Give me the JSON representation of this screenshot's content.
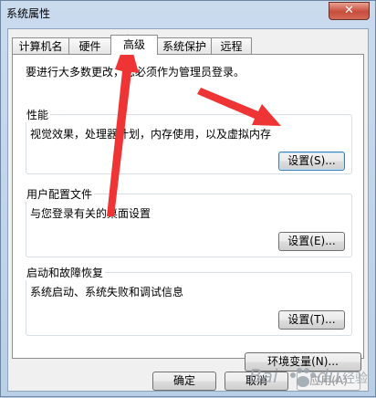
{
  "window": {
    "title": "系统属性",
    "close_label": "✕"
  },
  "tabs": [
    {
      "label": "计算机名"
    },
    {
      "label": "硬件"
    },
    {
      "label": "高级"
    },
    {
      "label": "系统保护"
    },
    {
      "label": "远程"
    }
  ],
  "advanced": {
    "admin_note": "要进行大多数更改，您必须作为管理员登录。",
    "performance": {
      "title": "性能",
      "desc": "视觉效果，处理器计划，内存使用，以及虚拟内存",
      "button": "设置(S)..."
    },
    "user_profiles": {
      "title": "用户配置文件",
      "desc": "与您登录有关的桌面设置",
      "button": "设置(E)..."
    },
    "startup_recovery": {
      "title": "启动和故障恢复",
      "desc": "系统启动、系统失败和调试信息",
      "button": "设置(T)..."
    },
    "env_button": "环境变量(N)..."
  },
  "footer": {
    "ok": "确定",
    "cancel": "取消",
    "apply": "应用(A)"
  },
  "watermark": {
    "text": "Bai du 经验"
  },
  "colors": {
    "arrow": "#ee3434"
  }
}
